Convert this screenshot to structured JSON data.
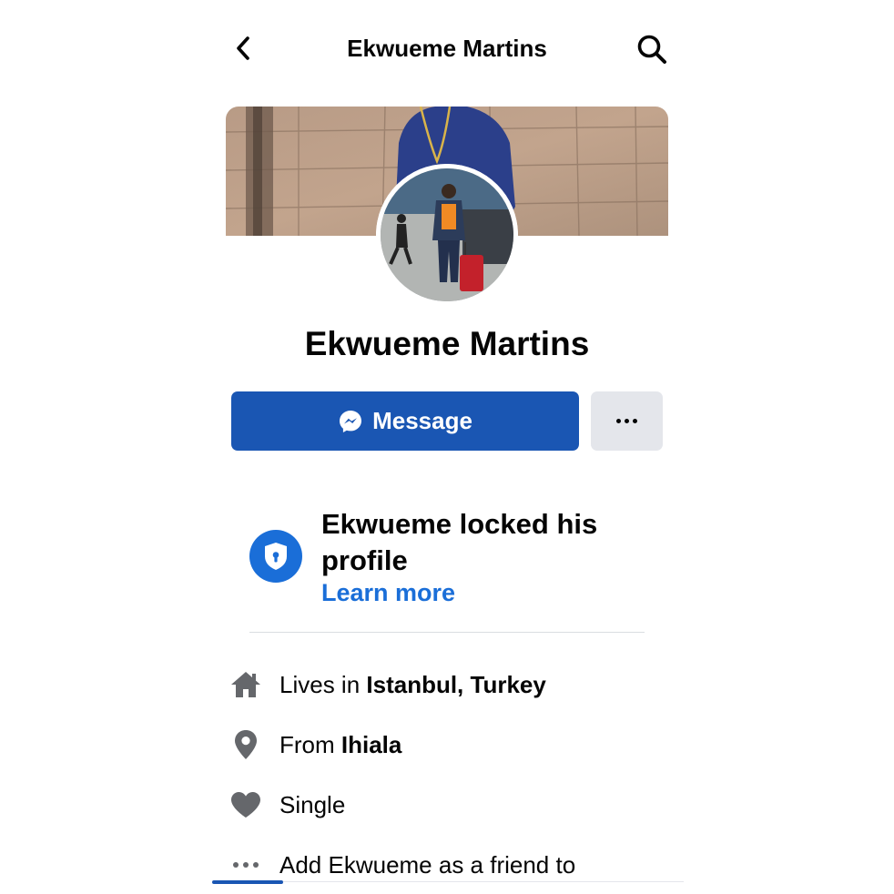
{
  "header": {
    "title": "Ekwueme Martins",
    "back_icon": "chevron-left-icon",
    "search_icon": "search-icon"
  },
  "profile": {
    "name": "Ekwueme Martins"
  },
  "actions": {
    "message_label": "Message",
    "message_icon": "messenger-icon",
    "more_icon": "more-dots-icon"
  },
  "locked": {
    "title": "Ekwueme locked his profile",
    "link": "Learn more",
    "icon": "shield-lock-icon"
  },
  "details": {
    "lives_prefix": "Lives in ",
    "lives_value": "Istanbul, Turkey",
    "from_prefix": "From ",
    "from_value": "Ihiala",
    "relationship": "Single",
    "add_friend": "Add Ekwueme as a friend to"
  },
  "colors": {
    "primary": "#1a56b3",
    "link": "#1a6ed8",
    "secondary_button": "#e4e6eb",
    "icon_gray": "#65676b"
  }
}
